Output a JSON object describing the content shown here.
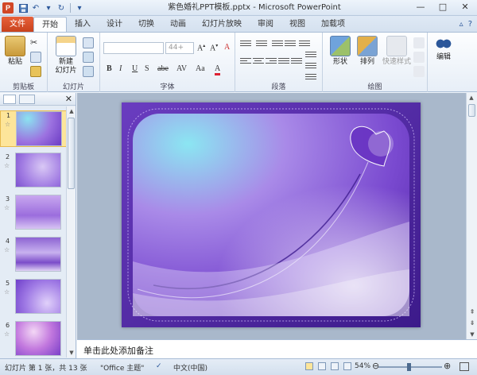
{
  "window": {
    "title": "紫色婚礼PPT模板.pptx - Microsoft PowerPoint",
    "app_icon": "P"
  },
  "tabs": [
    "文件",
    "开始",
    "插入",
    "设计",
    "切换",
    "动画",
    "幻灯片放映",
    "审阅",
    "视图",
    "加载项"
  ],
  "active_tab": "开始",
  "ribbon": {
    "clipboard": {
      "paste": "粘贴",
      "label": "剪贴板"
    },
    "slides": {
      "new_slide_line1": "新建",
      "new_slide_line2": "幻灯片",
      "label": "幻灯片"
    },
    "font": {
      "label": "字体",
      "size_value": "44+"
    },
    "paragraph": {
      "label": "段落"
    },
    "drawing": {
      "shape": "形状",
      "arrange": "排列",
      "quick_style": "快速样式",
      "label": "绘图"
    },
    "editing": {
      "edit": "编辑"
    }
  },
  "thumbnails": [
    {
      "num": "1",
      "star": "☆"
    },
    {
      "num": "2",
      "star": "☆"
    },
    {
      "num": "3",
      "star": "☆"
    },
    {
      "num": "4",
      "star": "☆"
    },
    {
      "num": "5",
      "star": "☆"
    },
    {
      "num": "6",
      "star": "☆"
    }
  ],
  "notes": {
    "placeholder": "单击此处添加备注"
  },
  "status": {
    "slide_info": "幻灯片 第 1 张，共 13 张",
    "theme": "\"Office 主题\"",
    "language": "中文(中国)",
    "zoom": "54%"
  },
  "colors": {
    "file_tab": "#d24726",
    "accent": "#2b579a",
    "slide_purple": "#7a3fc8"
  }
}
